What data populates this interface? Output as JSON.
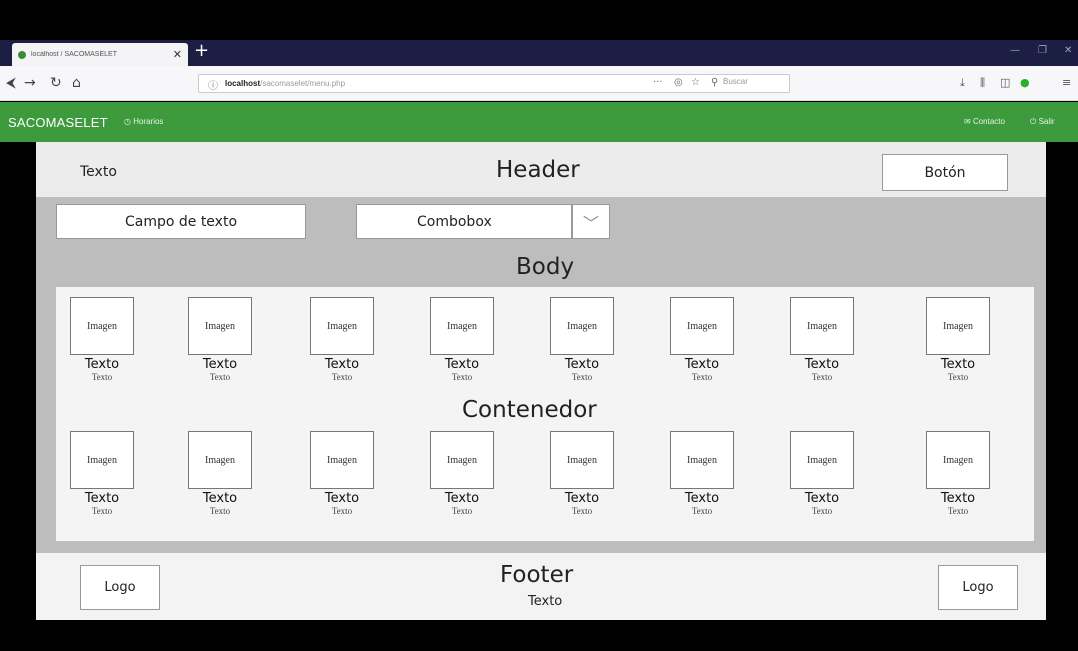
{
  "browser": {
    "tab_title": "localhost / SACOMASELET",
    "tab_close": "✕",
    "new_tab": "+",
    "url_info": "ⓘ",
    "url_host": "localhost",
    "url_path": "/sacomaselet/menu.php",
    "url_more": "···",
    "search_placeholder": "Buscar"
  },
  "app_nav": {
    "brand": "SACOMASELET",
    "horarios": "Horarios",
    "contacto": "Contacto",
    "salir": "Salir"
  },
  "wireframe": {
    "header": {
      "left_text": "Texto",
      "title": "Header",
      "button": "Botón"
    },
    "body": {
      "text_field": "Campo de texto",
      "combobox": "Combobox",
      "title": "Body"
    },
    "container": {
      "title": "Contenedor",
      "rows": [
        [
          {
            "image": "Imagen",
            "title": "Texto",
            "subtitle": "Texto"
          },
          {
            "image": "Imagen",
            "title": "Texto",
            "subtitle": "Texto"
          },
          {
            "image": "Imagen",
            "title": "Texto",
            "subtitle": "Texto"
          },
          {
            "image": "Imagen",
            "title": "Texto",
            "subtitle": "Texto"
          },
          {
            "image": "Imagen",
            "title": "Texto",
            "subtitle": "Texto"
          },
          {
            "image": "Imagen",
            "title": "Texto",
            "subtitle": "Texto"
          },
          {
            "image": "Imagen",
            "title": "Texto",
            "subtitle": "Texto"
          },
          {
            "image": "Imagen",
            "title": "Texto",
            "subtitle": "Texto"
          }
        ],
        [
          {
            "image": "Imagen",
            "title": "Texto",
            "subtitle": "Texto"
          },
          {
            "image": "Imagen",
            "title": "Texto",
            "subtitle": "Texto"
          },
          {
            "image": "Imagen",
            "title": "Texto",
            "subtitle": "Texto"
          },
          {
            "image": "Imagen",
            "title": "Texto",
            "subtitle": "Texto"
          },
          {
            "image": "Imagen",
            "title": "Texto",
            "subtitle": "Texto"
          },
          {
            "image": "Imagen",
            "title": "Texto",
            "subtitle": "Texto"
          },
          {
            "image": "Imagen",
            "title": "Texto",
            "subtitle": "Texto"
          },
          {
            "image": "Imagen",
            "title": "Texto",
            "subtitle": "Texto"
          }
        ]
      ]
    },
    "footer": {
      "logo_left": "Logo",
      "title": "Footer",
      "text": "Texto",
      "logo_right": "Logo"
    }
  },
  "colors": {
    "app_nav": "#3d9a3d",
    "tab_strip": "#1c1e44",
    "body_gray": "#bdbdbd"
  }
}
